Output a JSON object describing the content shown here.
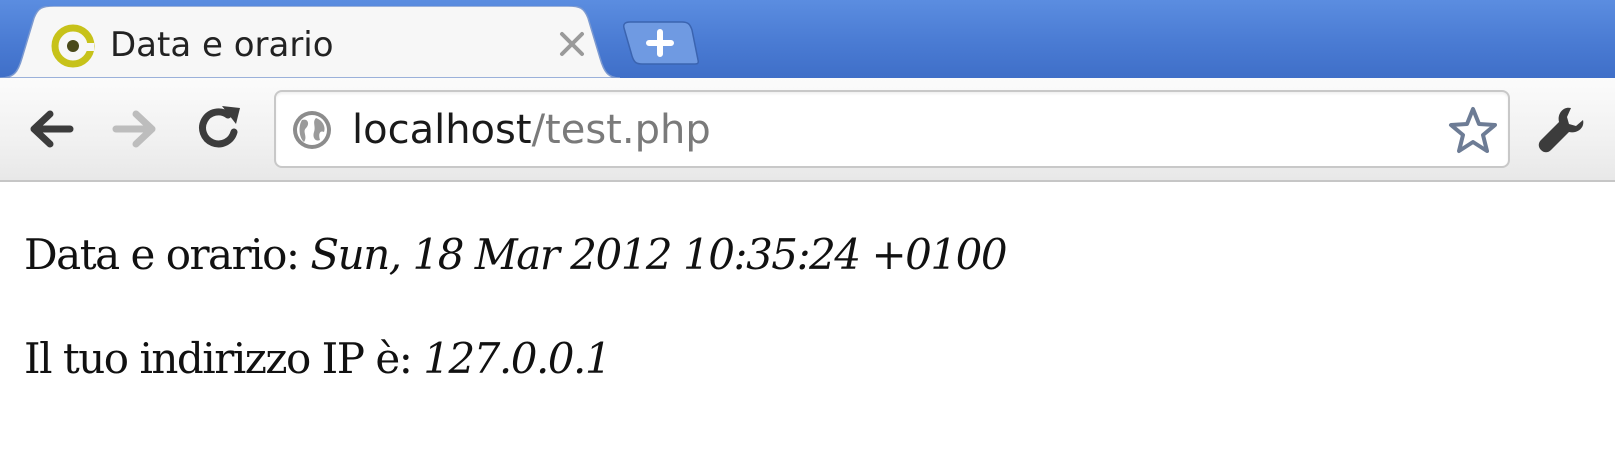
{
  "browser": {
    "tab": {
      "title": "Data e orario",
      "favicon_icon": "circle-logo-icon",
      "close_icon": "close-icon"
    },
    "new_tab_icon": "plus-icon",
    "toolbar": {
      "back_icon": "back-arrow-icon",
      "forward_icon": "forward-arrow-icon",
      "reload_icon": "reload-icon",
      "wrench_icon": "wrench-icon",
      "star_icon": "star-icon",
      "globe_icon": "globe-icon"
    },
    "address": {
      "host": "localhost",
      "path": "/test.php"
    },
    "colors": {
      "tabstrip": "#4a7bd3",
      "favicon": "#c7c21a"
    }
  },
  "page": {
    "datetime_label": "Data e orario:",
    "datetime_value": "Sun, 18 Mar 2012 10:35:24 +0100",
    "ip_label": "Il tuo indirizzo IP è:",
    "ip_value": "127.0.0.1"
  }
}
